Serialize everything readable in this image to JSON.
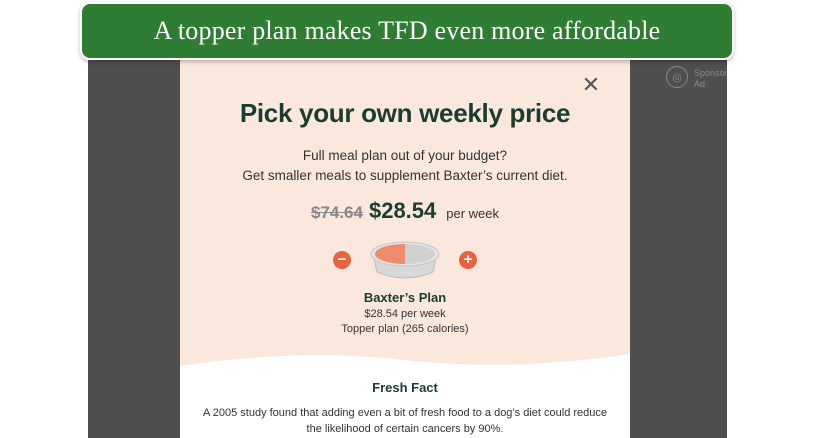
{
  "banner": {
    "title": "A topper plan makes TFD even more affordable"
  },
  "background": {
    "side_text_line1": "Sponsored",
    "side_text_line2": "Ad"
  },
  "modal": {
    "close_icon": "close-icon",
    "title": "Pick your own weekly price",
    "subtitle_line1": "Full meal plan out of your budget?",
    "subtitle_line2": "Get smaller meals to supplement Baxter’s current diet.",
    "old_price": "$74.64",
    "new_price": "$28.54",
    "per_week": "per week",
    "stepper": {
      "minus_label": "−",
      "plus_label": "+",
      "bowl_fill_percent": 50
    },
    "plan": {
      "name": "Baxter’s Plan",
      "price_line": "$28.54 per week",
      "type_line": "Topper plan (265 calories)"
    },
    "fact": {
      "title": "Fresh Fact",
      "line1": "A 2005 study found that adding even a bit of fresh food to a dog’s diet could reduce",
      "line2": "the likelihood of certain cancers by 90%."
    }
  },
  "colors": {
    "banner": "#2f7d32",
    "modal_bg": "#fbe8dc",
    "accent": "#e8633f",
    "heading": "#1b3d2e"
  }
}
